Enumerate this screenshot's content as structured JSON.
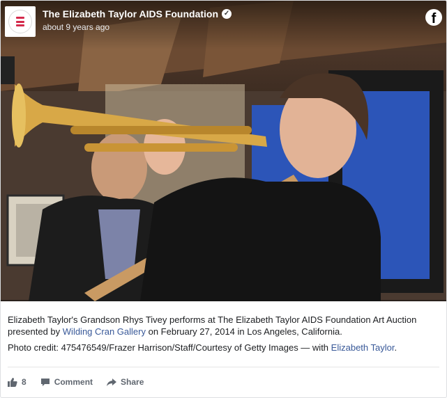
{
  "header": {
    "page_name": "The Elizabeth Taylor AIDS Foundation",
    "verified_icon": "verified-check-icon",
    "timestamp": "about 9 years ago",
    "platform_icon": "facebook-icon",
    "platform_glyph": "f"
  },
  "avatar": {
    "logo_ring_text": "THE ELIZABETH TAYLOR AIDS FOUNDATION",
    "brand_color": "#d42a4c"
  },
  "caption": {
    "line1_prefix": "Elizabeth Taylor's Grandson Rhys Tivey performs at The Elizabeth Taylor AIDS Foundation Art Auction presented by ",
    "gallery_link": "Wilding Cran Gallery",
    "line1_suffix": " on February 27, 2014 in Los Angeles, California.",
    "credit_prefix": "Photo credit: 475476549/Frazer Harrison/Staff/Courtesy of Getty Images — with ",
    "tagged_link": "Elizabeth Taylor",
    "credit_suffix": "."
  },
  "actions": {
    "like_count": "8",
    "comment_label": "Comment",
    "share_label": "Share"
  },
  "colors": {
    "link": "#385898",
    "action_text": "#606770"
  }
}
